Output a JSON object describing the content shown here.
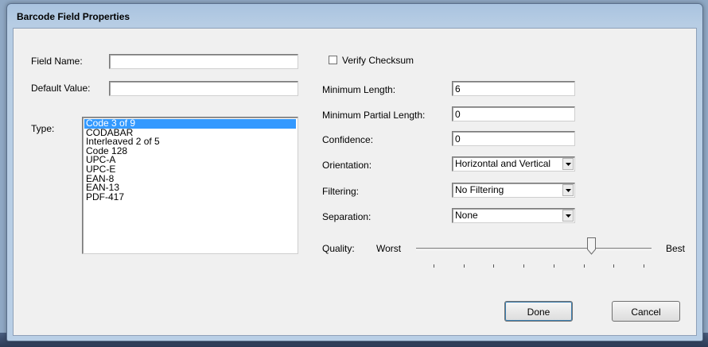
{
  "window": {
    "title": "Barcode Field Properties"
  },
  "left": {
    "field_name_label": "Field Name:",
    "field_name_value": "",
    "default_value_label": "Default Value:",
    "default_value_value": "",
    "type_label": "Type:",
    "type_options": [
      "Code 3 of 9",
      "CODABAR",
      "Interleaved 2 of 5",
      "Code 128",
      "UPC-A",
      "UPC-E",
      "EAN-8",
      "EAN-13",
      "PDF-417"
    ],
    "type_selected": "Code 3 of 9"
  },
  "right": {
    "verify_checksum_label": "Verify Checksum",
    "verify_checksum_checked": false,
    "min_length_label": "Minimum Length:",
    "min_length_value": "6",
    "min_partial_length_label": "Minimum Partial Length:",
    "min_partial_length_value": "0",
    "confidence_label": "Confidence:",
    "confidence_value": "0",
    "orientation_label": "Orientation:",
    "orientation_value": "Horizontal and Vertical",
    "filtering_label": "Filtering:",
    "filtering_value": "No Filtering",
    "separation_label": "Separation:",
    "separation_value": "None",
    "quality_label": "Quality:",
    "quality_min_label": "Worst",
    "quality_max_label": "Best",
    "quality_tick_count": 8,
    "quality_position_fraction": 0.75
  },
  "buttons": {
    "done": "Done",
    "cancel": "Cancel"
  },
  "icons": {
    "dropdown": "chevron-down-icon",
    "slider_thumb": "slider-thumb-icon"
  }
}
